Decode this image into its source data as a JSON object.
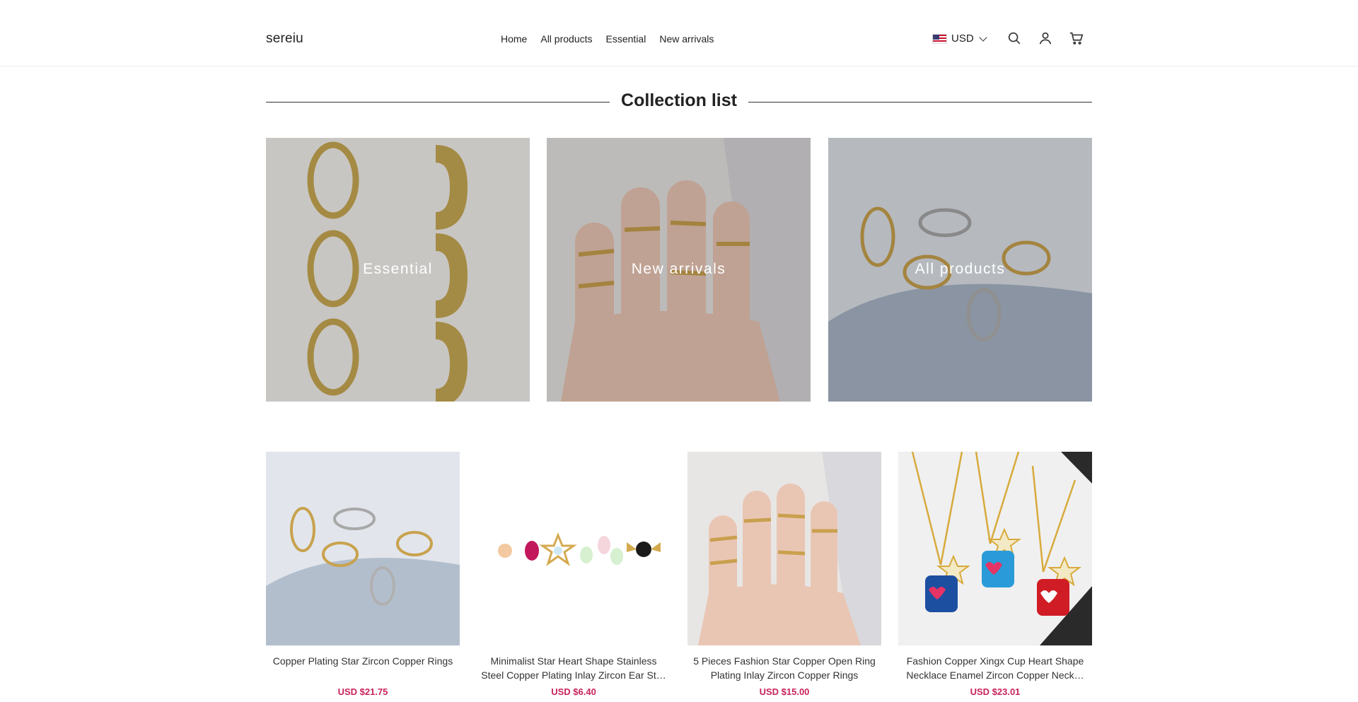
{
  "header": {
    "logo": "sereiu",
    "nav": [
      "Home",
      "All products",
      "Essential",
      "New arrivals"
    ],
    "currency": "USD",
    "icons": [
      "search-icon",
      "account-icon",
      "cart-icon"
    ]
  },
  "collection": {
    "title": "Collection list",
    "cards": [
      {
        "label": "Essential"
      },
      {
        "label": "New arrivals"
      },
      {
        "label": "All products"
      }
    ]
  },
  "products": [
    {
      "title": "Copper Plating Star Zircon Copper Rings",
      "price": "USD $21.75"
    },
    {
      "title": "Minimalist Star Heart Shape Stainless Steel Copper Plating Inlay Zircon Ear St…",
      "price": "USD $6.40"
    },
    {
      "title": "5 Pieces Fashion Star Copper Open Ring Plating Inlay Zircon Copper Rings",
      "price": "USD $15.00"
    },
    {
      "title": "Fashion Copper Xingx Cup Heart Shape Necklace Enamel Zircon Copper Neck…",
      "price": "USD $23.01"
    }
  ],
  "colors": {
    "price": "#c8235a",
    "text": "#222222"
  }
}
